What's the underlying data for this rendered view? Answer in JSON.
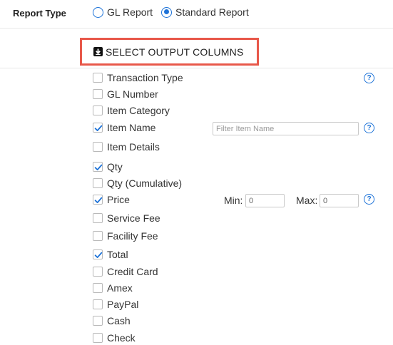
{
  "report_type": {
    "label": "Report Type",
    "options": [
      {
        "label": "GL Report",
        "checked": false
      },
      {
        "label": "Standard Report",
        "checked": true
      }
    ]
  },
  "output_columns": {
    "title": "SELECT OUTPUT COLUMNS",
    "items": [
      {
        "label": "Transaction Type",
        "checked": false
      },
      {
        "label": "GL Number",
        "checked": false
      },
      {
        "label": "Item Category",
        "checked": false
      },
      {
        "label": "Item Name",
        "checked": true
      },
      {
        "label": "Item Details",
        "checked": false
      },
      {
        "label": "Qty",
        "checked": true
      },
      {
        "label": "Qty (Cumulative)",
        "checked": false
      },
      {
        "label": "Price",
        "checked": true
      },
      {
        "label": "Service Fee",
        "checked": false
      },
      {
        "label": "Facility Fee",
        "checked": false
      },
      {
        "label": "Total",
        "checked": true
      },
      {
        "label": "Credit Card",
        "checked": false
      },
      {
        "label": "Amex",
        "checked": false
      },
      {
        "label": "PayPal",
        "checked": false
      },
      {
        "label": "Cash",
        "checked": false
      },
      {
        "label": "Check",
        "checked": false
      }
    ]
  },
  "filter_item_name": {
    "placeholder": "Filter Item Name"
  },
  "price_range": {
    "min_label": "Min:",
    "min_value": "0",
    "max_label": "Max:",
    "max_value": "0"
  },
  "help_glyph": "?"
}
